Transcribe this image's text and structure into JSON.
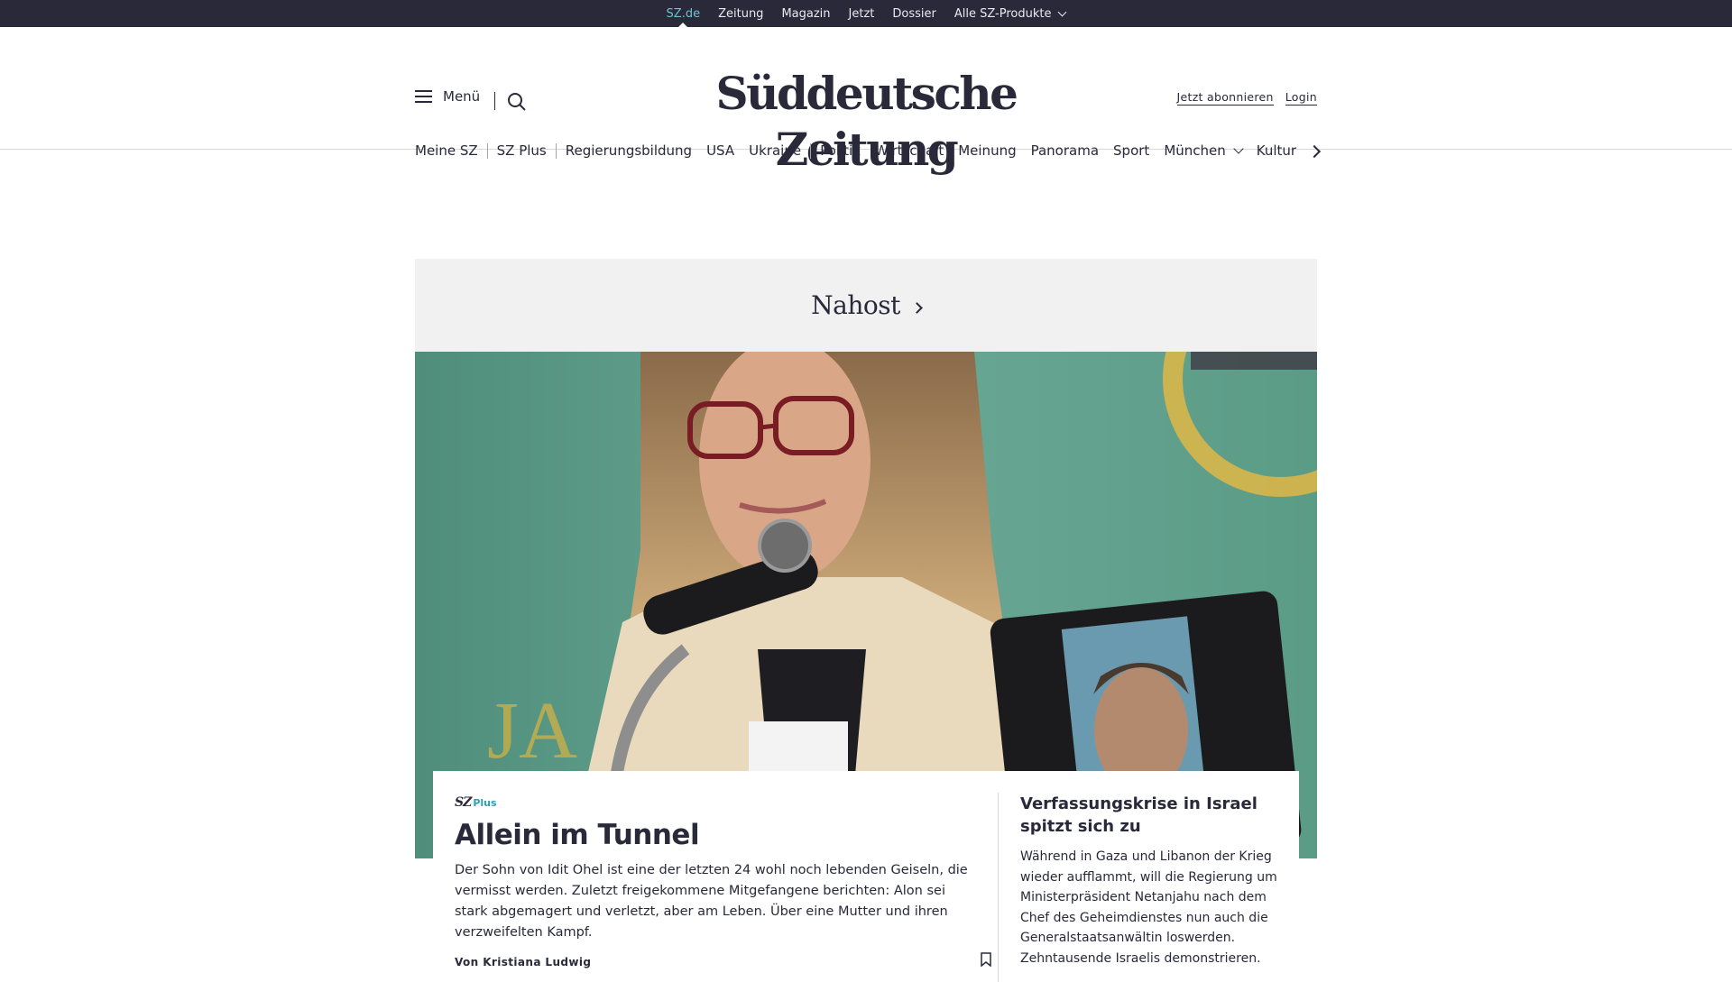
{
  "products": {
    "items": [
      "SZ.de",
      "Zeitung",
      "Magazin",
      "Jetzt",
      "Dossier",
      "Alle SZ-Produkte"
    ],
    "active": "SZ.de"
  },
  "header": {
    "menu_label": "Menü",
    "logo_text": "Süddeutsche Zeitung",
    "subscribe_label": "Jetzt abonnieren",
    "login_label": "Login"
  },
  "nav": {
    "items": [
      "Meine SZ",
      "SZ Plus",
      "Regierungsbildung",
      "USA",
      "Ukraine",
      "Politik",
      "Wirtschaft",
      "Meinung",
      "Panorama",
      "Sport",
      "München",
      "Kultur"
    ]
  },
  "section": {
    "title": "Nahost"
  },
  "teaser": {
    "badge_sz": "SZ",
    "badge_plus": "Plus",
    "headline": "Allein im Tunnel",
    "summary": "Der Sohn von Idit Ohel ist eine der letzten 24 wohl noch lebenden Geiseln, die vermisst werden. Zuletzt freigekommene Mitgefangene berichten: Alon sei stark abgemagert und verletzt, aber am Leben. Über eine Mutter und ihren verzweifelten Kampf.",
    "author": "Von Kristiana Ludwig"
  },
  "side_teaser": {
    "headline": "Verfassungskrise in Israel spitzt sich zu",
    "summary": "Während in Gaza und Libanon der Krieg wieder aufflammt, will die Regierung um Ministerpräsident Netanjahu nach dem Chef des Geheimdienstes nun auch die Generalstaatsanwältin loswerden. Zehntausende Israelis demonstrieren."
  },
  "colors": {
    "topbar_bg": "#29293a",
    "active_product": "#71c1cf",
    "sz_plus": "#2aa0b4",
    "section_bg": "#f1f1f1",
    "photo_bg": "#5e9e8a"
  }
}
